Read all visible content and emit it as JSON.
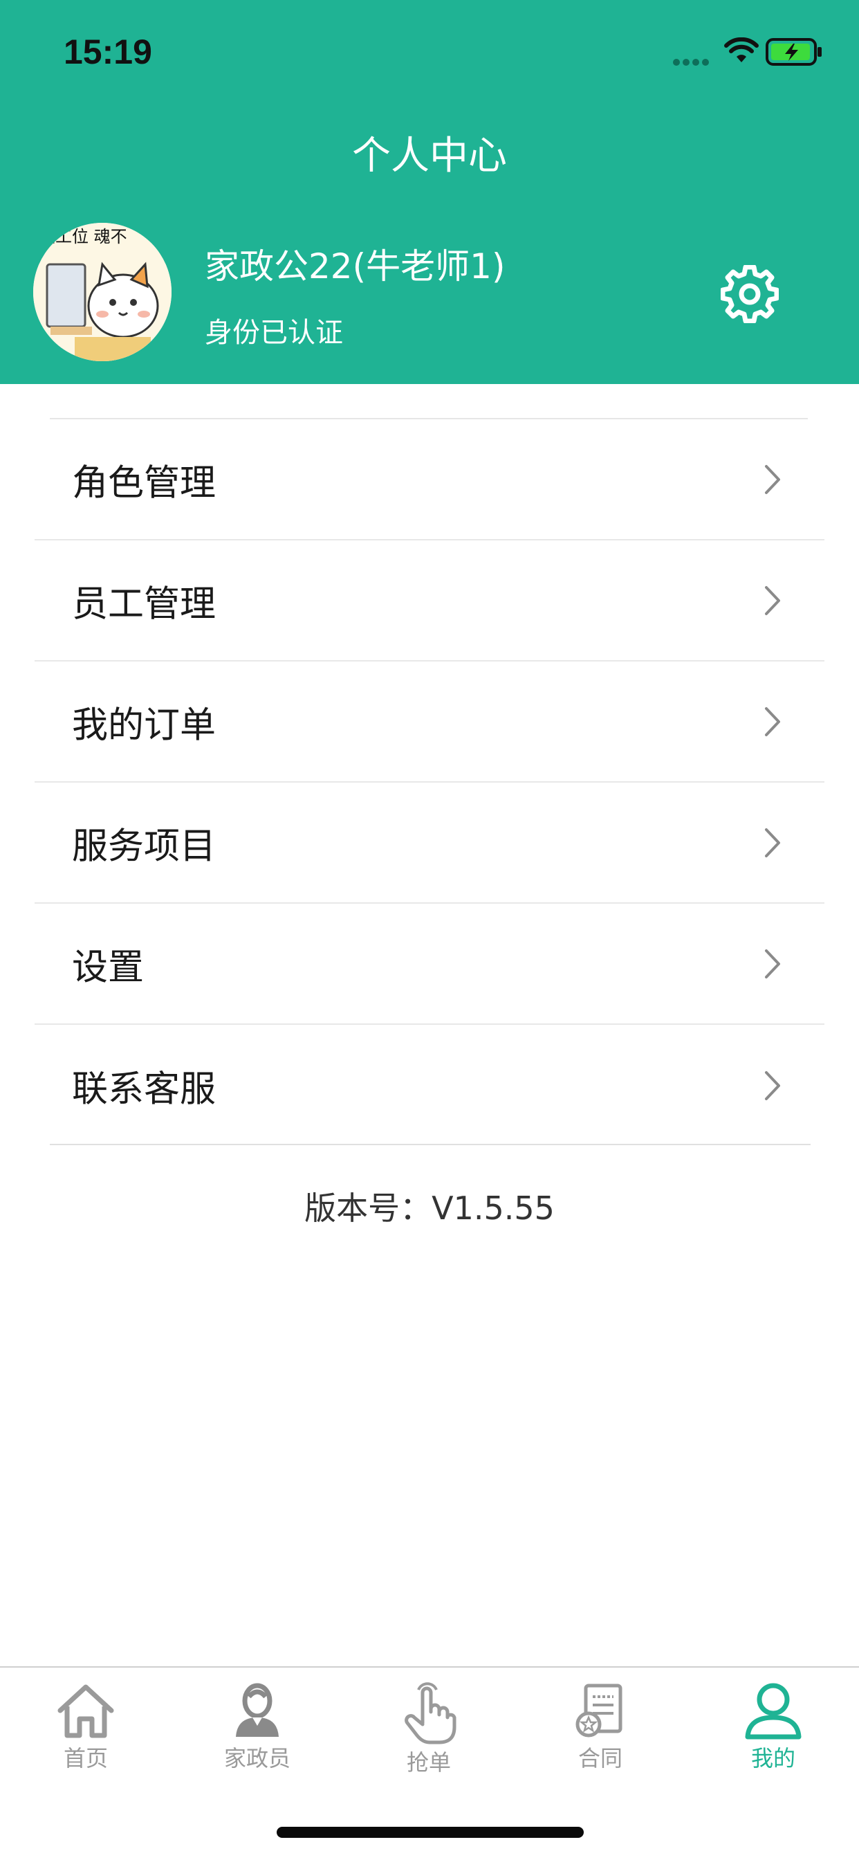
{
  "status_bar": {
    "time": "15:19"
  },
  "header": {
    "title": "个人中心",
    "user_name": "家政公22(牛老师1)",
    "user_status": "身份已认证",
    "accent": "#1fb394"
  },
  "avatar": {
    "caption": "在工位 魂不"
  },
  "menu": {
    "items": [
      {
        "label": "角色管理"
      },
      {
        "label": "员工管理"
      },
      {
        "label": "我的订单"
      },
      {
        "label": "服务项目"
      },
      {
        "label": "设置"
      },
      {
        "label": "联系客服"
      }
    ]
  },
  "version": "版本号：V1.5.55",
  "tabbar": {
    "tabs": [
      {
        "label": "首页",
        "icon": "home-icon"
      },
      {
        "label": "家政员",
        "icon": "housekeeper-icon"
      },
      {
        "label": "抢单",
        "icon": "tap-hand-icon"
      },
      {
        "label": "合同",
        "icon": "contract-icon"
      },
      {
        "label": "我的",
        "icon": "profile-icon",
        "active": true
      }
    ]
  }
}
